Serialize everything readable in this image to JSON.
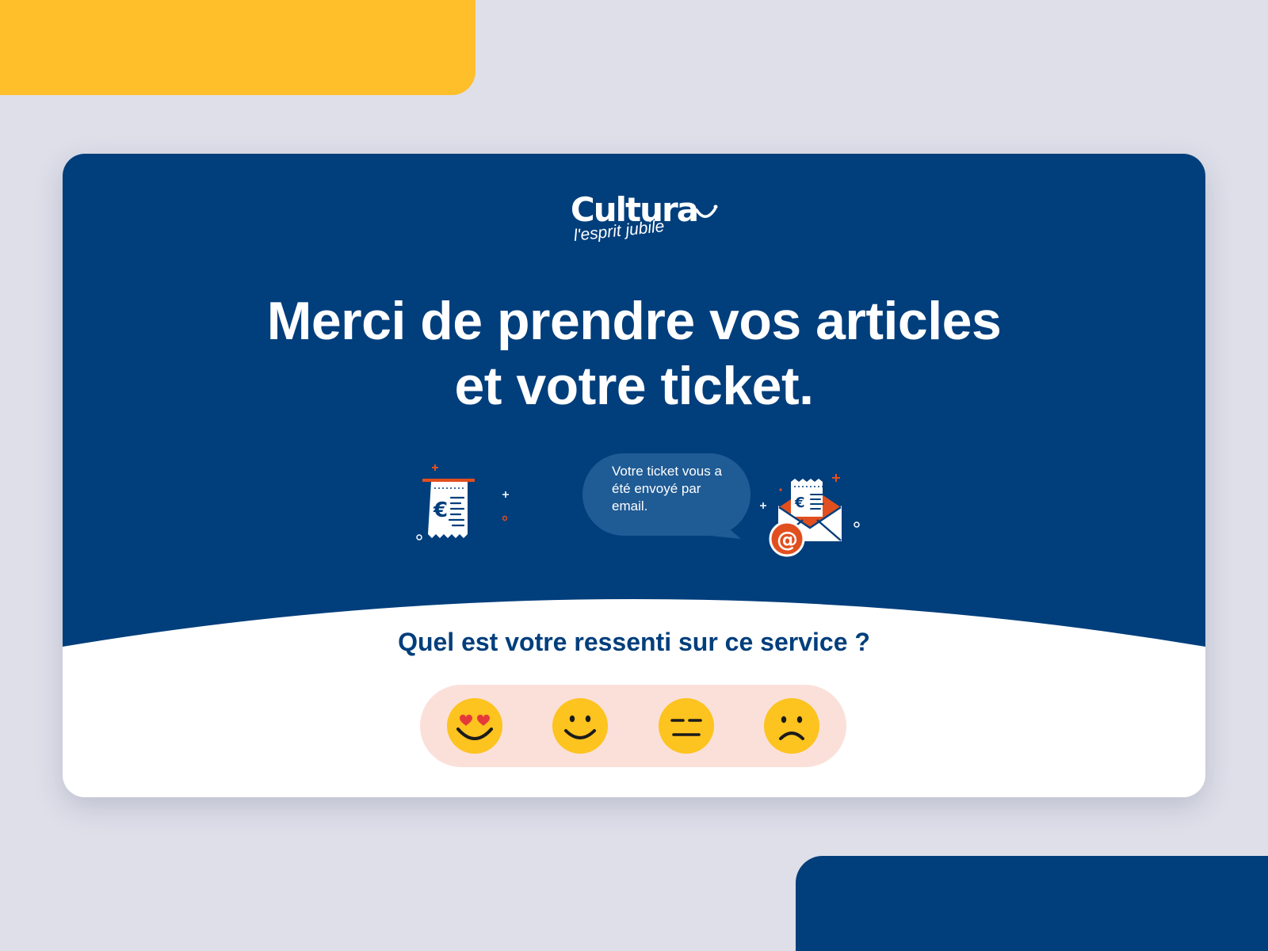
{
  "brand": {
    "name": "Cultura",
    "tagline": "l'esprit jubile"
  },
  "headline": {
    "line1": "Merci de prendre vos articles",
    "line2": "et votre ticket."
  },
  "bubble": {
    "text": "Votre ticket vous a été envoyé par email."
  },
  "survey": {
    "question": "Quel est votre ressenti sur ce service ?",
    "options": [
      {
        "icon": "heart-eyes-face-icon"
      },
      {
        "icon": "smiling-face-icon"
      },
      {
        "icon": "neutral-face-icon"
      },
      {
        "icon": "frowning-face-icon"
      }
    ]
  },
  "illustrations": {
    "receipt_symbol": "€",
    "email_symbol": "@"
  },
  "colors": {
    "navy": "#003e7c",
    "yellow": "#ffbf2b",
    "emoji_yellow": "#fdc31f",
    "accent_orange": "#e24f1f",
    "pill_pink": "#fbe0da",
    "page_background": "#dedfe9"
  }
}
